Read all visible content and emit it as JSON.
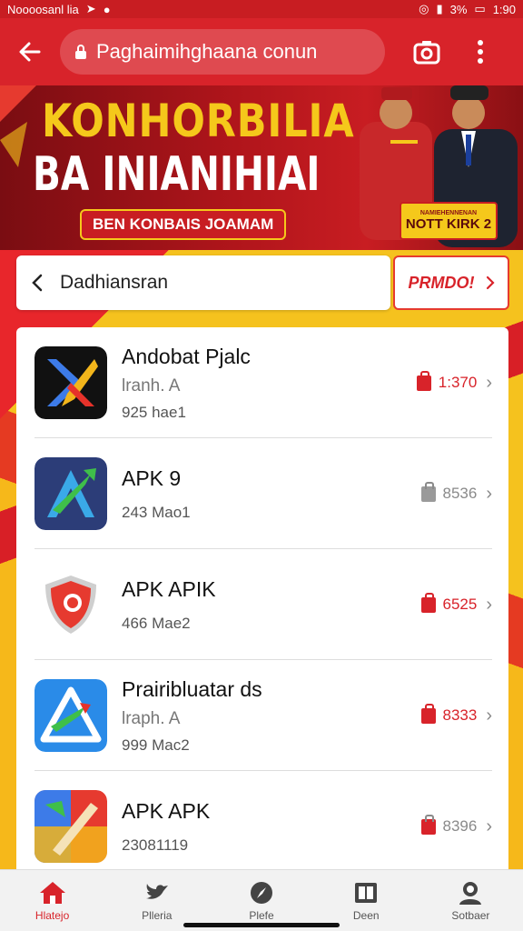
{
  "status_bar": {
    "left_text": "Noooosanl lia",
    "battery_text": "3%",
    "time": "1:90"
  },
  "toolbar": {
    "url_text": "Paghaimihghaana conun"
  },
  "banner": {
    "title": "KONHORBILIA",
    "subtitle": "BA INIANIHIAI",
    "cta_label": "BEN KONBAIS JOAMAM",
    "badge_small": "NAMIEHENNENAN",
    "badge_large": "NOTT KIRK 2"
  },
  "breadcrumb": {
    "label": "Dadhiansran"
  },
  "promo": {
    "label": "PRMDO!"
  },
  "apps": [
    {
      "name": "Andobat Pjalc",
      "subtitle": "lranh. A",
      "meta": "925 hae1",
      "price": "1:370",
      "price_style": "red",
      "icon": "pen-x-icon"
    },
    {
      "name": "APK 9",
      "subtitle": "",
      "meta": "243 Mao1",
      "price": "8536",
      "price_style": "gray",
      "icon": "arrow-a-icon"
    },
    {
      "name": "APK APIK",
      "subtitle": "",
      "meta": "466 Mae2",
      "price": "6525",
      "price_style": "red",
      "icon": "shield-icon"
    },
    {
      "name": "Prairibluatar ds",
      "subtitle": "lraph. A",
      "meta": "999 Mac2",
      "price": "8333",
      "price_style": "red",
      "icon": "triangle-arrow-icon"
    },
    {
      "name": "APK APK",
      "subtitle": "",
      "meta": "23081119",
      "price": "8396",
      "price_style": "gray",
      "icon": "brush-icon"
    }
  ],
  "bottom_nav": [
    {
      "label": "Hlatejo",
      "icon": "home-icon",
      "active": true
    },
    {
      "label": "Plleria",
      "icon": "bird-icon",
      "active": false
    },
    {
      "label": "Plefe",
      "icon": "compass-icon",
      "active": false
    },
    {
      "label": "Deen",
      "icon": "book-icon",
      "active": false
    },
    {
      "label": "Sotbaer",
      "icon": "avatar-icon",
      "active": false
    }
  ],
  "colors": {
    "brand_red": "#d8232a",
    "banner_gold": "#f5c81b",
    "background_yellow": "#f3b21c"
  }
}
